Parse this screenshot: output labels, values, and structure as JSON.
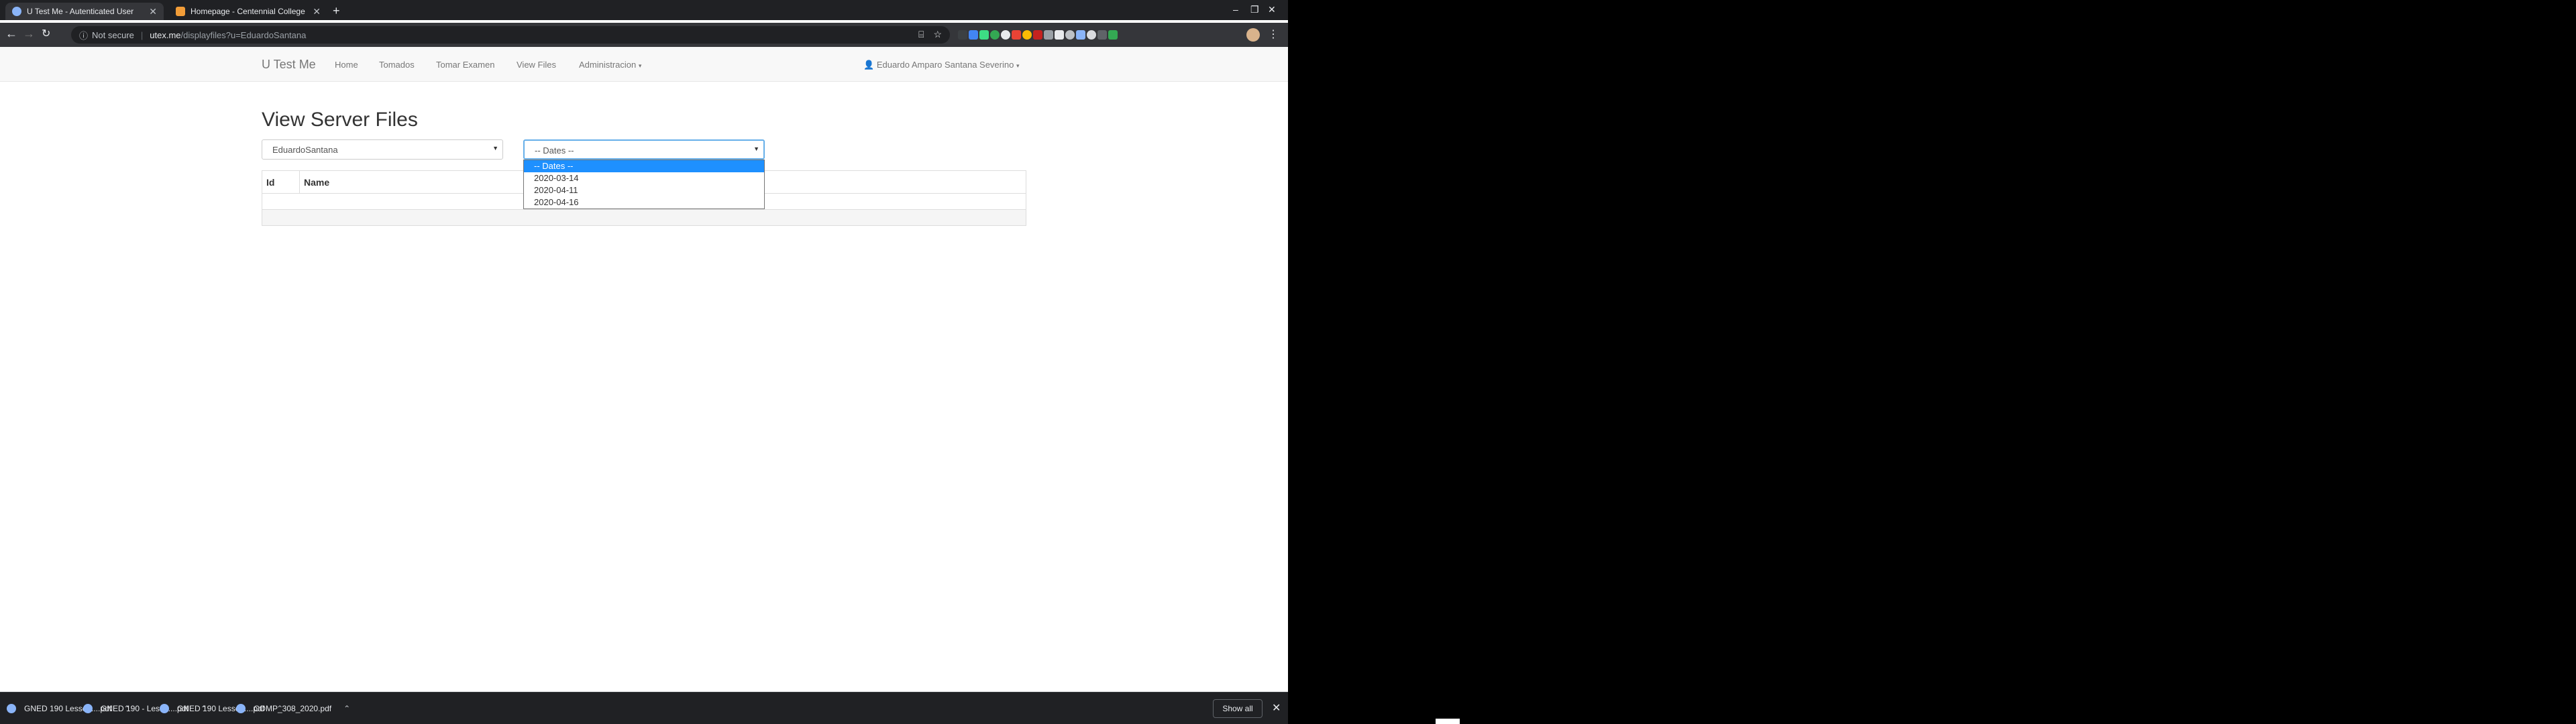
{
  "tabs": [
    {
      "title": "U Test Me - Autenticated User",
      "favicon_color": "#8ab4f8"
    },
    {
      "title": "Homepage - Centennial College",
      "favicon_color": "#f29d38"
    }
  ],
  "omnibox": {
    "security": "Not secure",
    "host": "utex.me",
    "path": "/displayfiles?u=EduardoSantana"
  },
  "navbar": {
    "brand": "U Test Me",
    "links": [
      "Home",
      "Tomados",
      "Tomar Examen",
      "View Files",
      "Administracion"
    ],
    "user": "Eduardo Amparo Santana Severino"
  },
  "page": {
    "title": "View Server Files",
    "user_select": "EduardoSantana",
    "dates_select": "-- Dates --",
    "dates_options": [
      "-- Dates --",
      "2020-03-14",
      "2020-04-11",
      "2020-04-16"
    ],
    "table_headers": [
      "Id",
      "Name"
    ]
  },
  "downloads": [
    {
      "name": "GNED 190 Lesson....pdf"
    },
    {
      "name": "GNED 190 - Lesso....pdf"
    },
    {
      "name": "GNED 190 Lesson....pdf"
    },
    {
      "name": "COMP_308_2020.pdf"
    }
  ],
  "download_bar": {
    "show_all": "Show all"
  },
  "colors": {
    "selected_option": "#1e90ff",
    "focus_border": "#66afe9"
  }
}
